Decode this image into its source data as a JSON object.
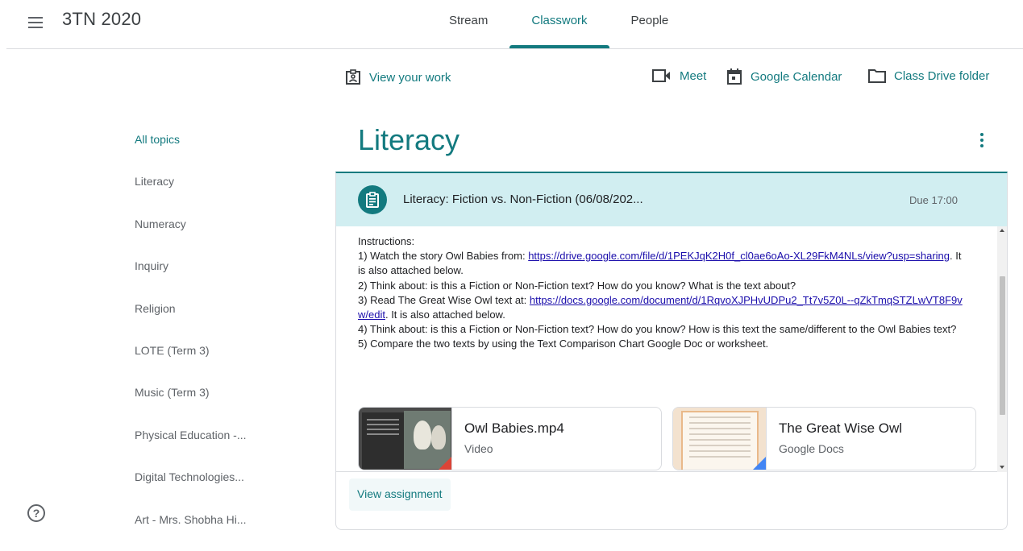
{
  "header": {
    "class_name": "3TN 2020",
    "tabs": [
      {
        "label": "Stream",
        "active": false
      },
      {
        "label": "Classwork",
        "active": true
      },
      {
        "label": "People",
        "active": false
      }
    ]
  },
  "actions": {
    "view_work": "View your work",
    "meet": "Meet",
    "calendar": "Google Calendar",
    "drive": "Class Drive folder"
  },
  "sidebar": {
    "topics": [
      "All topics",
      "Literacy",
      "Numeracy",
      "Inquiry",
      "Religion",
      "LOTE (Term 3)",
      "Music (Term 3)",
      "Physical Education -...",
      "Digital Technologies...",
      "Art - Mrs. Shobha Hi..."
    ],
    "active_topic": "All topics"
  },
  "topic_section": {
    "heading": "Literacy"
  },
  "assignment": {
    "title": "Literacy: Fiction vs. Non-Fiction (06/08/202...",
    "due": "Due 17:00",
    "instructions": {
      "heading": "Instructions:",
      "line1_text": "1) Watch the story Owl Babies from: ",
      "line1_link": "https://drive.google.com/file/d/1PEKJqK2H0f_cl0ae6oAo-XL29FkM4NLs/view?usp=sharing",
      "line1_after": ". It is also attached below.",
      "line2": "2) Think about: is this a Fiction or Non-Fiction text? How do you know? What is the text about?",
      "line3_text": "3) Read The Great Wise Owl text at: ",
      "line3_link": "https://docs.google.com/document/d/1RqvoXJPHvUDPu2_Tt7v5Z0L--qZkTmqSTZLwVT8F9vw/edit",
      "line3_after": ".  It is also attached below.",
      "line4": "4) Think about: is this a Fiction or Non-Fiction text? How do you know? How is this text the same/different to the Owl Babies text?",
      "line5": "5) Compare the two texts by using the Text Comparison Chart Google Doc or worksheet."
    },
    "attachments": [
      {
        "name": "Owl Babies.mp4",
        "type": "Video"
      },
      {
        "name": "The Great Wise Owl",
        "type": "Google Docs"
      }
    ],
    "view_button": "View assignment"
  },
  "colors": {
    "accent": "#137a7f",
    "card_header_bg": "#d1eef1",
    "link": "#1a0dab",
    "video_corner": "#db4437",
    "docs_corner": "#4285f4"
  },
  "icons": [
    "menu-icon",
    "assignment-icon",
    "video-camera-icon",
    "calendar-icon",
    "folder-icon",
    "more-vert-icon",
    "help-icon"
  ]
}
